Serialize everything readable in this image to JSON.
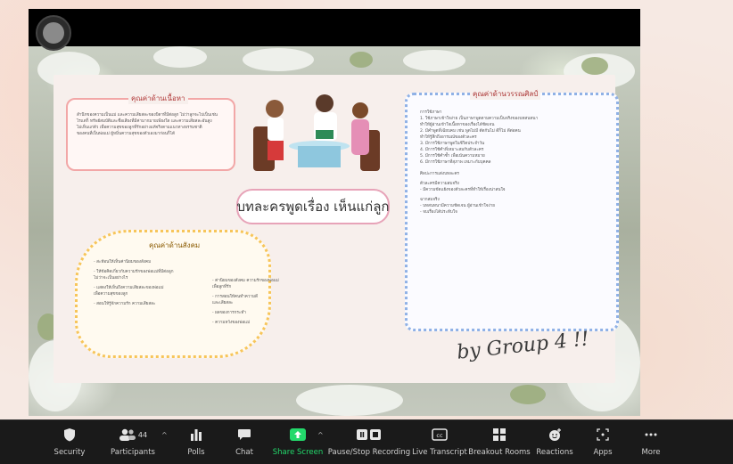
{
  "meeting": {
    "slide": {
      "main_title": "บทละครพูดเรื่อง เห็นแก่ลูก",
      "content_title": "คุณค่าด้านเนื้อหา",
      "content_lines": [
        "สำนึกของความเป็นแม่ และความเสียสละของบิดาที่มีต่อลูก ไม่ว่าลูกจะไปเป็นเช่น",
        "ไรแต่ก็ ทรัพย์สมบัติและชื่อเสียงที่มีค่ามากมายเพียงใด และความเสียสละอันสูง",
        "ไม่เห็นแก่ตัว เพื่อความสุขของลูกที่รักอย่างแท้จริงตามแนวทางธรรมชาติ",
        "ของคนที่เป็นพ่อแม่ ผู้หมิ่นความสุขของตัวเองมาก่อนก็ได้"
      ],
      "art_title": "คุณค่าด้านวรรณศิลป์",
      "art_lines": [
        "การใช้ภาษา",
        "1. ใช้ภาษาเข้าใจง่าย เป็นภาษาพูดตามความเป็นจริงของบทสนทนา",
        "ทำให้ผู้อ่านเข้าใจเนื้อหาของเรื่องได้ชัดเจน",
        "2. มีคำพูดที่เฉียบคม เช่น พูดไม่มี ตัดกันไม่ ดีก็ไม่ ดีต่อคน",
        "ทำให้รู้สึกถึงอารมณ์ของตัวละคร",
        "3. มีการใช้ภาษาพูดในชีวิตประจำวัน",
        "4. มีการใช้คำที่เหมาะสมกับตัวละคร",
        "5. มีการใช้คำซ้ำ เพื่อเน้นความหมาย",
        "6. มีการใช้ภาษาที่สุภาพ เหมาะกับบุคคล",
        "ศิลปะการแต่งบทละคร",
        "ตัวละครมีความสมจริง",
        "- มีความขัดแย้งของตัวละครที่ทำให้เรื่องน่าสนใจ",
        "ฉากสมจริง",
        "- บทสนทนามีความชัดเจน ผู้อ่านเข้าใจง่าย",
        "- จบเรื่องได้ประทับใจ"
      ],
      "social_title": "คุณค่าด้านสังคม",
      "social_lines": [
        "- สะท้อนให้เห็นค่านิยมของสังคม",
        "- ให้ข้อคิดเกี่ยวกับความรักของพ่อแม่ที่มีต่อลูก",
        "  ไม่ว่าจะเป็นอย่างไร",
        "- แสดงให้เห็นถึงความเสียสละของพ่อแม่",
        "  เพื่อความสุขของลูก",
        "- สอนให้รู้จักความรัก ความเสียสละ"
      ],
      "social_right_lines": [
        "- ค่านิยมของสังคม ความรักของพ่อแม่",
        "  เพื่อลูกที่รัก",
        "- การสอนให้คนทำความดี",
        "  และเสียสละ",
        "- ผลของการกระทำ",
        "- ความหวังของพ่อแม่"
      ],
      "signature": "by Group 4 !!"
    },
    "toolbar": {
      "items": [
        {
          "label": "Security",
          "icon": "shield-icon"
        },
        {
          "label": "Participants",
          "icon": "participants-icon",
          "count": "44"
        },
        {
          "label": "Polls",
          "icon": "polls-icon"
        },
        {
          "label": "Chat",
          "icon": "chat-icon"
        },
        {
          "label": "Share Screen",
          "icon": "share-screen-icon"
        },
        {
          "label": "Pause/Stop Recording",
          "icon": "recording-icon"
        },
        {
          "label": "Live Transcript",
          "icon": "cc-icon"
        },
        {
          "label": "Breakout Rooms",
          "icon": "breakout-rooms-icon"
        },
        {
          "label": "Reactions",
          "icon": "reactions-icon"
        },
        {
          "label": "Apps",
          "icon": "apps-icon"
        },
        {
          "label": "More",
          "icon": "more-icon"
        }
      ],
      "share_color": "#23d96b"
    }
  }
}
